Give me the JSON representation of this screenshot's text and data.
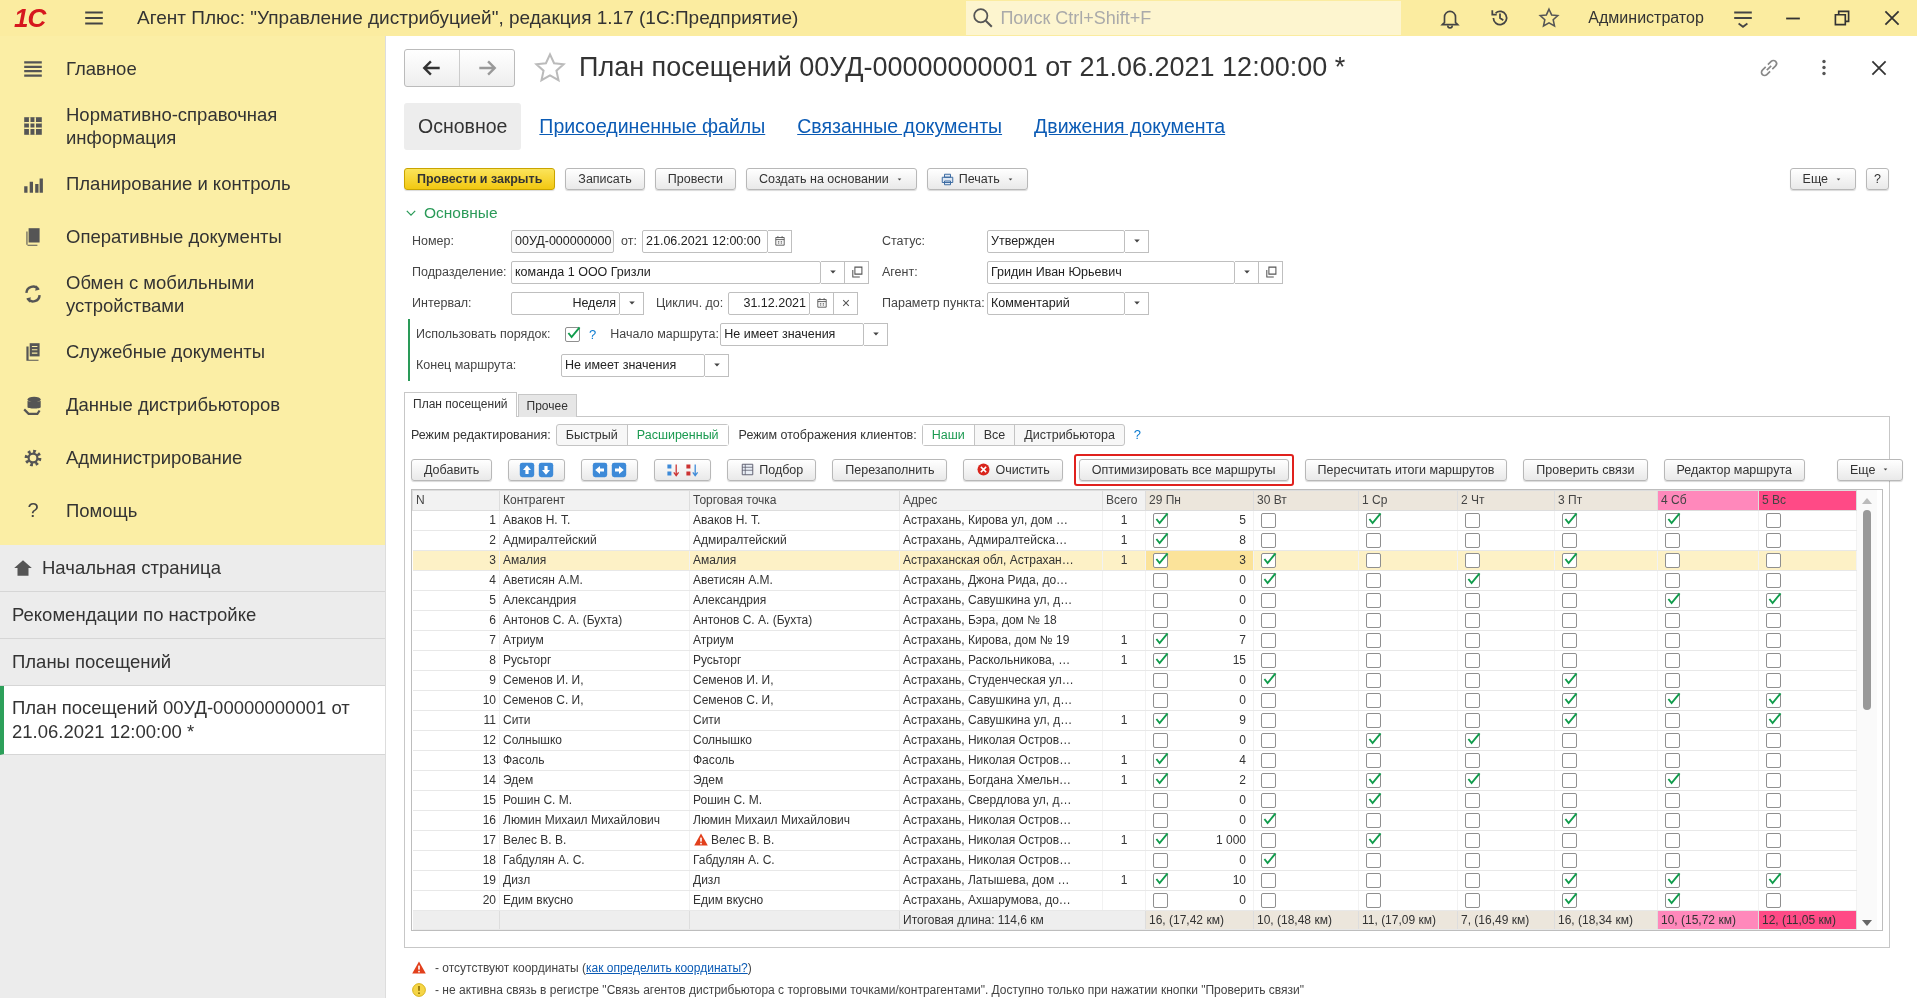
{
  "window": {
    "logo": "1С",
    "title": "Агент Плюс: \"Управление дистрибуцией\", редакция 1.17  (1С:Предприятие)",
    "search": {
      "placeholder": "Поиск Ctrl+Shift+F"
    },
    "user": "Администратор"
  },
  "sidebar": {
    "items": [
      {
        "label": "Главное"
      },
      {
        "label": "Нормативно-справочная информация"
      },
      {
        "label": "Планирование и контроль"
      },
      {
        "label": "Оперативные документы"
      },
      {
        "label": "Обмен с мобильными устройствами"
      },
      {
        "label": "Служебные документы"
      },
      {
        "label": "Данные дистрибьюторов"
      },
      {
        "label": "Администрирование"
      },
      {
        "label": "Помощь",
        "glyph": "?"
      }
    ],
    "open_windows": [
      {
        "label": "Начальная страница",
        "home": true,
        "selected": false
      },
      {
        "label": "Рекомендации по настройке",
        "home": false,
        "selected": false
      },
      {
        "label": "Планы посещений",
        "home": false,
        "selected": false
      },
      {
        "label": "План посещений 00УД-00000000001 от 21.06.2021 12:00:00 *",
        "home": false,
        "selected": true
      }
    ]
  },
  "document": {
    "title": "План посещений 00УД-00000000001 от 21.06.2021 12:00:00 *",
    "favorite": false,
    "tabs": [
      {
        "label": "Основное",
        "selected": true
      },
      {
        "label": "Присоединенные файлы",
        "selected": false
      },
      {
        "label": "Связанные документы",
        "selected": false
      },
      {
        "label": "Движения документа",
        "selected": false
      }
    ],
    "commands": [
      {
        "label": "Провести и закрыть",
        "kind": "primary"
      },
      {
        "label": "Записать",
        "kind": "plain"
      },
      {
        "label": "Провести",
        "kind": "plain"
      },
      {
        "label": "Создать на основании",
        "kind": "menu"
      },
      {
        "label": "Печать",
        "kind": "print"
      }
    ],
    "more": "Еще",
    "help": "?"
  },
  "form": {
    "group_title": "Основные",
    "group_expanded": true,
    "number_label": "Номер:",
    "number": "00УД-000000000",
    "date_label": "от:",
    "date": "21.06.2021 12:00:00",
    "status_label": "Статус:",
    "status": "Утвержден",
    "division_label": "Подразделение:",
    "division": "команда 1 ООО Гризли",
    "agent_label": "Агент:",
    "agent": "Гридин Иван Юрьевич",
    "interval_label": "Интервал:",
    "interval": "Неделя",
    "cycle_label": "Циклич. до:",
    "cycle": "31.12.2021",
    "param_label": "Параметр пункта:",
    "param": "Комментарий",
    "use_order_label": "Использовать порядок:",
    "use_order": true,
    "help": "?",
    "route_start_label": "Начало маршрута:",
    "route_start": "Не имеет значения",
    "route_end_label": "Конец маршрута:",
    "route_end": "Не имеет значения"
  },
  "inner_tabs": [
    {
      "label": "План посещений",
      "selected": true
    },
    {
      "label": "Прочее",
      "selected": false
    }
  ],
  "edit_mode": {
    "label": "Режим редактирования:",
    "options": [
      {
        "label": "Быстрый",
        "selected": false
      },
      {
        "label": "Расширенный",
        "selected": true
      }
    ]
  },
  "client_mode": {
    "label": "Режим отображения клиентов:",
    "options": [
      {
        "label": "Наши",
        "selected": true
      },
      {
        "label": "Все",
        "selected": false
      },
      {
        "label": "Дистрибьютора",
        "selected": false
      }
    ],
    "help": "?"
  },
  "toolbar": [
    {
      "kind": "text",
      "label": "Добавить",
      "highlighted": false
    },
    {
      "kind": "updown",
      "highlighted": false
    },
    {
      "kind": "leftright",
      "highlighted": false
    },
    {
      "kind": "sort",
      "highlighted": false
    },
    {
      "kind": "pick",
      "label": "Подбор",
      "highlighted": false
    },
    {
      "kind": "text",
      "label": "Перезаполнить",
      "highlighted": false
    },
    {
      "kind": "clear",
      "label": "Очистить",
      "highlighted": false
    },
    {
      "kind": "text",
      "label": "Оптимизировать все маршруты",
      "highlighted": true
    },
    {
      "kind": "text",
      "label": "Пересчитать итоги маршрутов",
      "highlighted": false
    },
    {
      "kind": "text",
      "label": "Проверить связи",
      "highlighted": false
    },
    {
      "kind": "text",
      "label": "Редактор маршрута",
      "highlighted": false
    }
  ],
  "toolbar_more": "Еще",
  "table": {
    "columns": [
      "N",
      "Контрагент",
      "Торговая точка",
      "Адрес",
      "Всего"
    ],
    "day_columns": [
      {
        "label": "29 Пн",
        "color": "#ece6dc",
        "total": "16, (17,42 км)"
      },
      {
        "label": "30 Вт",
        "color": "#ece6dc",
        "total": "10, (18,48 км)"
      },
      {
        "label": "1 Ср",
        "color": "#ece6dc",
        "total": "11, (17,09 км)"
      },
      {
        "label": "2 Чт",
        "color": "#ece6dc",
        "total": "7, (16,49 км)"
      },
      {
        "label": "3 Пт",
        "color": "#ece6dc",
        "total": "16, (18,34 км)"
      },
      {
        "label": "4 Сб",
        "color": "#ff88bb",
        "total": "10, (15,72 км)"
      },
      {
        "label": "5 Вс",
        "color": "#ff4a86",
        "total": "12, (11,05 км)"
      }
    ],
    "footer_label": "Итоговая длина: 114,6 км",
    "rows": [
      {
        "n": "1",
        "counterparty": "Аваков Н. Т.",
        "outlet": "Аваков Н. Т.",
        "address": "Астрахань, Кирова ул, дом …",
        "total": "1",
        "order": "5",
        "days": [
          true,
          false,
          true,
          false,
          true,
          true,
          false
        ],
        "selected": false,
        "warning": false
      },
      {
        "n": "2",
        "counterparty": "Адмиралтейский",
        "outlet": "Адмиралтейский",
        "address": "Астрахань, Адмиралтейска…",
        "total": "1",
        "order": "8",
        "days": [
          true,
          false,
          false,
          false,
          false,
          false,
          false
        ],
        "selected": false,
        "warning": false
      },
      {
        "n": "3",
        "counterparty": "Амалия",
        "outlet": "Амалия",
        "address": "Астраханская обл, Астрахан…",
        "total": "1",
        "order": "3",
        "days": [
          true,
          true,
          false,
          false,
          true,
          false,
          false
        ],
        "selected": true,
        "warning": false
      },
      {
        "n": "4",
        "counterparty": "Аветисян А.М.",
        "outlet": "Аветисян А.М.",
        "address": "Астрахань, Джона Рида, до…",
        "order": "0",
        "days": [
          false,
          true,
          false,
          true,
          false,
          false,
          false
        ],
        "selected": false,
        "warning": false
      },
      {
        "n": "5",
        "counterparty": "Александрия",
        "outlet": "Александрия",
        "address": "Астрахань, Савушкина ул, д…",
        "order": "0",
        "days": [
          false,
          false,
          false,
          false,
          false,
          true,
          true
        ],
        "selected": false,
        "warning": false
      },
      {
        "n": "6",
        "counterparty": "Антонов С. А. (Бухта)",
        "outlet": "Антонов С. А. (Бухта)",
        "address": "Астрахань, Бэра, дом № 18",
        "order": "0",
        "days": [
          false,
          false,
          false,
          false,
          false,
          false,
          false
        ],
        "selected": false,
        "warning": false
      },
      {
        "n": "7",
        "counterparty": "Атриум",
        "outlet": "Атриум",
        "address": "Астрахань, Кирова, дом № 19",
        "total": "1",
        "order": "7",
        "days": [
          true,
          false,
          false,
          false,
          false,
          false,
          false
        ],
        "selected": false,
        "warning": false
      },
      {
        "n": "8",
        "counterparty": "Русьторг",
        "outlet": "Русьторг",
        "address": "Астрахань, Раскольникова, …",
        "total": "1",
        "order": "15",
        "days": [
          true,
          false,
          false,
          false,
          false,
          false,
          false
        ],
        "selected": false,
        "warning": false
      },
      {
        "n": "9",
        "counterparty": "Семенов И. И,",
        "outlet": "Семенов И. И,",
        "address": "Астрахань, Студенческая ул…",
        "order": "0",
        "days": [
          false,
          true,
          false,
          false,
          true,
          false,
          false
        ],
        "selected": false,
        "warning": false
      },
      {
        "n": "10",
        "counterparty": "Семенов С. И,",
        "outlet": "Семенов С. И,",
        "address": "Астрахань, Савушкина ул, д…",
        "order": "0",
        "days": [
          false,
          false,
          false,
          false,
          true,
          true,
          true
        ],
        "selected": false,
        "warning": false
      },
      {
        "n": "11",
        "counterparty": "Сити",
        "outlet": "Сити",
        "address": "Астрахань, Савушкина ул, д…",
        "total": "1",
        "order": "9",
        "days": [
          true,
          false,
          false,
          false,
          true,
          false,
          true
        ],
        "selected": false,
        "warning": false
      },
      {
        "n": "12",
        "counterparty": "Солнышко",
        "outlet": "Солнышко",
        "address": "Астрахань, Николая Остров…",
        "order": "0",
        "days": [
          false,
          false,
          true,
          true,
          false,
          false,
          false
        ],
        "selected": false,
        "warning": false
      },
      {
        "n": "13",
        "counterparty": "Фасоль",
        "outlet": "Фасоль",
        "address": "Астрахань, Николая Остров…",
        "total": "1",
        "order": "4",
        "days": [
          true,
          false,
          false,
          false,
          false,
          false,
          false
        ],
        "selected": false,
        "warning": false
      },
      {
        "n": "14",
        "counterparty": "Эдем",
        "outlet": "Эдем",
        "address": "Астрахань, Богдана Хмельн…",
        "total": "1",
        "order": "2",
        "days": [
          true,
          false,
          true,
          true,
          false,
          true,
          false
        ],
        "selected": false,
        "warning": false
      },
      {
        "n": "15",
        "counterparty": "Рошин С. М.",
        "outlet": "Рошин С. М.",
        "address": "Астрахань, Свердлова ул, д…",
        "order": "0",
        "days": [
          false,
          false,
          true,
          false,
          false,
          false,
          false
        ],
        "selected": false,
        "warning": false
      },
      {
        "n": "16",
        "counterparty": "Люмин Михаил Михайлович",
        "outlet": "Люмин Михаил Михайлович",
        "address": "Астрахань, Николая Остров…",
        "order": "0",
        "days": [
          false,
          true,
          false,
          false,
          true,
          false,
          false
        ],
        "selected": false,
        "warning": false
      },
      {
        "n": "17",
        "counterparty": "Велес В. В.",
        "outlet": "Велес В. В.",
        "address": "Астрахань, Николая Остров…",
        "total": "1",
        "order": "1 000",
        "days": [
          true,
          false,
          true,
          false,
          false,
          false,
          false
        ],
        "selected": false,
        "warning": true
      },
      {
        "n": "18",
        "counterparty": "Габдулян А. С.",
        "outlet": "Габдулян А. С.",
        "address": "Астрахань, Николая Остров…",
        "order": "0",
        "days": [
          false,
          true,
          false,
          false,
          false,
          false,
          false
        ],
        "selected": false,
        "warning": false
      },
      {
        "n": "19",
        "counterparty": "Дизл",
        "outlet": "Дизл",
        "address": "Астрахань, Латышева, дом …",
        "total": "1",
        "order": "10",
        "days": [
          true,
          false,
          false,
          false,
          true,
          true,
          true
        ],
        "selected": false,
        "warning": false
      },
      {
        "n": "20",
        "counterparty": "Едим вкусно",
        "outlet": "Едим вкусно",
        "address": "Астрахань, Ахшарумова, до…",
        "order": "0",
        "days": [
          false,
          false,
          false,
          false,
          true,
          true,
          false
        ],
        "selected": false,
        "warning": false
      }
    ]
  },
  "legend": [
    {
      "kind": "warning",
      "text": "- отсутствуют координаты (",
      "link": "как определить координаты?",
      "after": ")"
    },
    {
      "kind": "inactive",
      "text": "- не активна связь в регистре \"Связь агентов дистрибьютора с торговыми точками/контрагентами\". Доступно только при нажатии кнопки \"Проверить связи\""
    }
  ]
}
